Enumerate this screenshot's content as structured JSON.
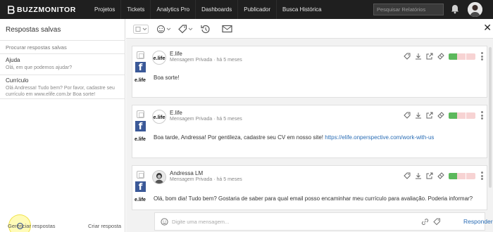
{
  "app": {
    "logo_text": "BUZZMONITOR",
    "nav": [
      "Projetos",
      "Tickets",
      "Analytics Pro",
      "Dashboards",
      "Publicador",
      "Busca Histórica"
    ],
    "search_placeholder": "Pesquisar Relatórios"
  },
  "left_panel": {
    "title": "Respostas salvas",
    "search_placeholder": "Procurar respostas salvas",
    "items": [
      {
        "title": "Ajuda",
        "text": "Olá, em que podemos ajudar?"
      },
      {
        "title": "Currículo",
        "text": "Olá Andressa! Tudo bem? Por favor, cadastre seu currículo em www.elife.com.br Boa sorte!"
      }
    ],
    "footer_manage": "Gerenciar respostas",
    "footer_create": "Criar resposta"
  },
  "messages": [
    {
      "author": "E.life",
      "meta": "Mensagem Privada · há 5 meses",
      "text": "Boa sorte!",
      "link": ""
    },
    {
      "author": "E.life",
      "meta": "Mensagem Privada · há 5 meses",
      "text": "Boa tarde, Andressa! Por gentileza, cadastre seu CV em nosso site! ",
      "link": "https://elife.onperspective.com/work-with-us"
    },
    {
      "author": "Andressa LM",
      "meta": "Mensagem Privada · há 5 meses",
      "text": "Olá, bom dia! Tudo bem? Gostaria de saber para qual email posso encaminhar meu currículo para avaliação. Poderia informar?",
      "link": ""
    }
  ],
  "source_badges": [
    "e.life",
    "e.life",
    "e.life"
  ],
  "composer": {
    "placeholder": "Digite uma mensagem...",
    "reply_label": "Responder"
  },
  "colors": {
    "navbar": "#1f1f1f",
    "facebook": "#3b5998",
    "status_green": "#5cb85c",
    "status_pink": "#f7d3d3",
    "link": "#2a6db5"
  }
}
